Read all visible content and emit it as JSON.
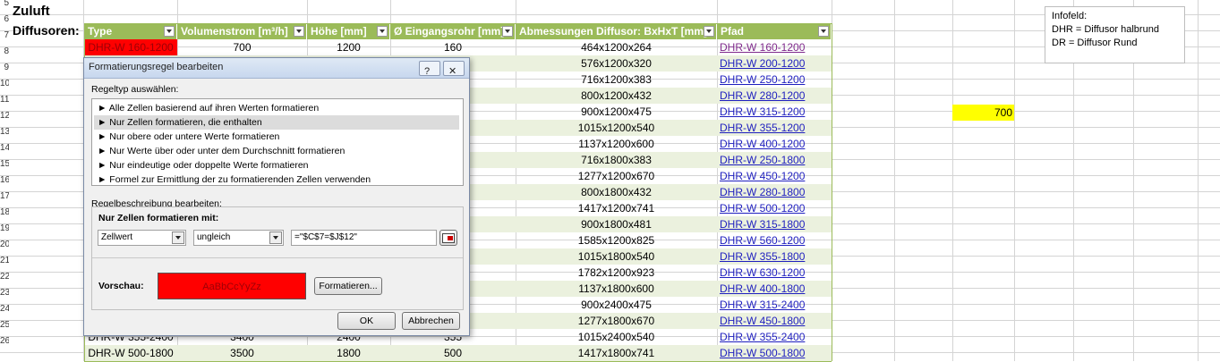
{
  "sheet": {
    "title": "Zuluft",
    "section_label": "Diffusoren:",
    "row_numbers": [
      "5",
      "6",
      "7",
      "8",
      "9",
      "10",
      "11",
      "12",
      "13",
      "14",
      "15",
      "16",
      "17",
      "18",
      "19",
      "20",
      "21",
      "22",
      "23",
      "24",
      "25",
      "26"
    ],
    "headers": [
      "Type",
      "Volumenstrom [m³/h]",
      "Höhe [mm]",
      "Ø Eingangsrohr [mm]",
      "Abmessungen Diffusor: BxHxT [mm]",
      "Pfad"
    ],
    "first_row": {
      "type": "DHR-W 160-1200",
      "volume": "700",
      "height": "1200",
      "pipe": "160",
      "dims": "464x1200x264",
      "path": "DHR-W 160-1200"
    },
    "dims_column": [
      "576x1200x320",
      "716x1200x383",
      "800x1200x432",
      "900x1200x475",
      "1015x1200x540",
      "1137x1200x600",
      "716x1800x383",
      "1277x1200x670",
      "800x1800x432",
      "1417x1200x741",
      "900x1800x481",
      "1585x1200x825",
      "1015x1800x540",
      "1782x1200x923",
      "1137x1800x600",
      "900x2400x475",
      "1277x1800x670",
      "1015x2400x540",
      "1417x1800x741"
    ],
    "path_column": [
      "DHR-W 200-1200",
      "DHR-W 250-1200",
      "DHR-W 280-1200",
      "DHR-W 315-1200",
      "DHR-W 355-1200",
      "DHR-W 400-1200",
      "DHR-W 250-1800",
      "DHR-W 450-1200",
      "DHR-W 280-1800",
      "DHR-W 500-1200",
      "DHR-W 315-1800",
      "DHR-W 560-1200",
      "DHR-W 355-1800",
      "DHR-W 630-1200",
      "DHR-W 400-1800",
      "DHR-W 315-2400",
      "DHR-W 450-1800",
      "DHR-W 355-2400",
      "DHR-W 500-1800"
    ],
    "partial_row": {
      "type": "DHR-W 355-2400",
      "volume": "3400",
      "height": "2400",
      "pipe": "355"
    },
    "last_row": {
      "type": "DHR-W 500-1800",
      "volume": "3500",
      "height": "1800",
      "pipe": "500"
    },
    "highlight_value": "700",
    "info_box": {
      "title": "Infofeld:",
      "line1": "DHR = Diffusor halbrund",
      "line2": "DR = Diffusor Rund"
    },
    "colors": {
      "header": "#9bbb59",
      "band": "#ebf1de",
      "highlight": "#ffff00",
      "red_cell": "#ff0000"
    }
  },
  "dialog": {
    "title": "Formatierungsregel bearbeiten",
    "help_icon": "?",
    "close_icon": "✕",
    "rule_type_label": "Regeltyp auswählen:",
    "rule_types": [
      "► Alle Zellen basierend auf ihren Werten formatieren",
      "► Nur Zellen formatieren, die enthalten",
      "► Nur obere oder untere Werte formatieren",
      "► Nur Werte über oder unter dem Durchschnitt formatieren",
      "► Nur eindeutige oder doppelte Werte formatieren",
      "► Formel zur Ermittlung der zu formatierenden Zellen verwenden"
    ],
    "selected_rule_index": 1,
    "description_label": "Regelbeschreibung bearbeiten:",
    "format_only_label": "Nur Zellen formatieren mit:",
    "combo1": "Zellwert",
    "combo2": "ungleich",
    "formula": "=\"$C$7=$J$12\"",
    "preview_label": "Vorschau:",
    "preview_text": "AaBbCcYyZz",
    "format_button": "Formatieren...",
    "ok_button": "OK",
    "cancel_button": "Abbrechen"
  }
}
